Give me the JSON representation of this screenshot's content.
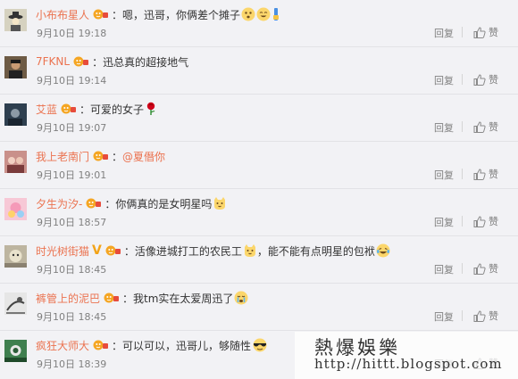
{
  "comments": [
    {
      "username": "小布布星人",
      "text": "嗯，迅哥，你俩差个摊子",
      "emoji": [
        "shocked-face-icon",
        "grin-face-icon",
        "zipper-emoji-icon"
      ],
      "time": "9月10日 19:18",
      "reply_label": "回复",
      "like_label": "赞",
      "avatar_color": "#c9c3a8"
    },
    {
      "username": "7FKNL",
      "text": "迅总真的超接地气",
      "emoji": [],
      "time": "9月10日 19:14",
      "reply_label": "回复",
      "like_label": "赞",
      "avatar_color": "#5a4a3a"
    },
    {
      "username": "艾蓝",
      "text": "可爱的女子",
      "emoji": [
        "rose-icon"
      ],
      "time": "9月10日 19:07",
      "reply_label": "回复",
      "like_label": "赞",
      "avatar_color": "#2e3f4f"
    },
    {
      "username": "我上老南门",
      "mention": "@夏僭你",
      "time": "9月10日 19:01",
      "reply_label": "回复",
      "like_label": "赞",
      "avatar_color": "#b77a72"
    },
    {
      "username": "夕生为汐-",
      "text": "你俩真的是女明星吗",
      "emoji": [
        "cat-face-icon"
      ],
      "time": "9月10日 18:57",
      "reply_label": "回复",
      "like_label": "赞",
      "avatar_color": "#e8a3b6"
    },
    {
      "username": "时光树街猫",
      "verified": "V",
      "text": "活像进城打工的农民工",
      "text2": "，能不能有点明星的包袱",
      "emoji": [
        "cat-face-icon"
      ],
      "emoji2": [
        "laughing-tears-icon"
      ],
      "time": "9月10日 18:45",
      "reply_label": "回复",
      "like_label": "赞",
      "avatar_color": "#a8a090"
    },
    {
      "username": "裤管上的泥巴",
      "text": "我tm实在太爱周迅了",
      "emoji": [
        "crying-face-icon"
      ],
      "time": "9月10日 18:45",
      "reply_label": "回复",
      "like_label": "赞",
      "avatar_color": "#d8d8d8"
    },
    {
      "username": "疯狂大师大",
      "text": "可以可以，迅哥儿，够随性",
      "emoji": [
        "sunglasses-face-icon"
      ],
      "time": "9月10日 18:39",
      "reply_label": "回复",
      "like_label": "赞",
      "avatar_color": "#2f6b3f"
    }
  ],
  "watermark": {
    "title": "熱爆娛樂",
    "url": "http://hittt.blogspot.com"
  }
}
